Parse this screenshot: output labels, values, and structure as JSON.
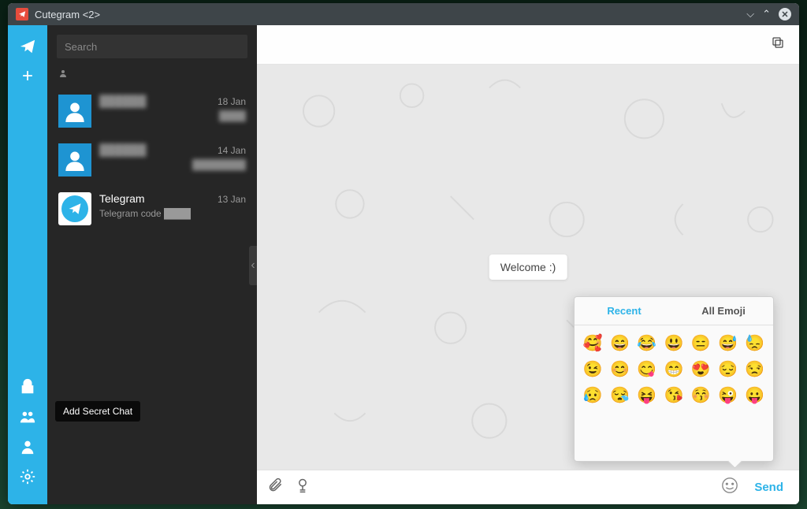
{
  "window": {
    "title": "Cutegram <2>",
    "controls": {
      "minimize": "minimize-icon",
      "maximize": "maximize-icon",
      "close": "close-icon"
    }
  },
  "rail": {
    "items": [
      {
        "icon": "send-icon"
      },
      {
        "icon": "plus-icon"
      },
      {
        "icon": "lock-icon"
      },
      {
        "icon": "group-icon"
      },
      {
        "icon": "person-icon"
      },
      {
        "icon": "gear-icon"
      }
    ]
  },
  "search": {
    "placeholder": "Search"
  },
  "chats": [
    {
      "name": "██████",
      "date": "18 Jan",
      "preview": "████",
      "avatar": "person",
      "blurred": true
    },
    {
      "name": "██████",
      "date": "14 Jan",
      "preview": "████████",
      "avatar": "person",
      "blurred": true
    },
    {
      "name": "Telegram",
      "date": "13 Jan",
      "preview": "Telegram code ████",
      "avatar": "telegram",
      "blurred": false
    }
  ],
  "tooltip": {
    "text": "Add Secret Chat"
  },
  "main": {
    "welcome": "Welcome :)"
  },
  "emoji_panel": {
    "tabs": {
      "recent": "Recent",
      "all": "All Emoji"
    },
    "active_tab": "recent",
    "emojis": [
      "🥰",
      "😄",
      "😂",
      "😃",
      "😑",
      "😅",
      "😓",
      "😉",
      "😊",
      "😋",
      "😁",
      "😍",
      "😔",
      "😒",
      "😥",
      "😪",
      "😝",
      "😘",
      "😚",
      "😜",
      "😛"
    ]
  },
  "compose": {
    "send_label": "Send"
  }
}
